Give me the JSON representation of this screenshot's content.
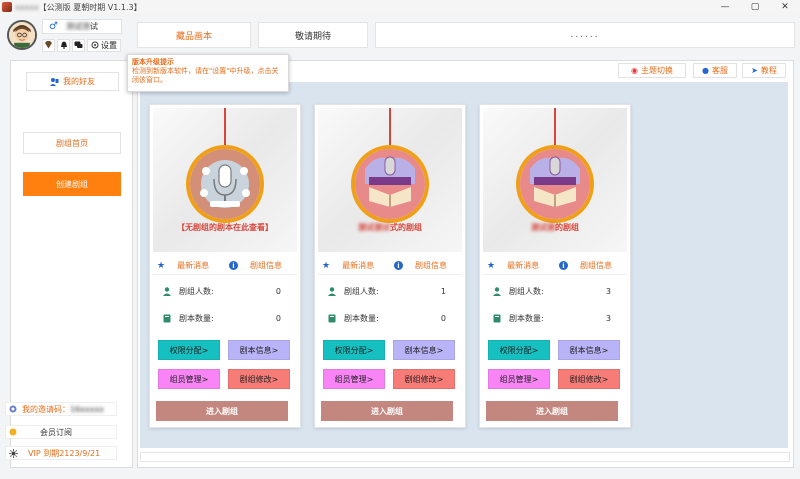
{
  "window": {
    "title_prefix": "【公测版 夏朝时期 V1.1.3】",
    "title_blur": "xxxxx",
    "minimize": "—",
    "maximize": "▢",
    "close": "✕"
  },
  "user": {
    "gender_symbol": "♂",
    "name_blur": "测试测",
    "name_suffix": "试",
    "settings_label": "设置"
  },
  "top": {
    "tab1": "藏品画本",
    "tab2": "敬请期待",
    "dots": "......"
  },
  "tooltip": {
    "title": "版本升级提示",
    "body": "检测到新版本软件，请在\"设置\"中升级，点击关闭该窗口。"
  },
  "sidebar": {
    "friends": "我的好友",
    "home": "剧组首页",
    "create": "创建剧组",
    "invite_label": "我的邀请码：",
    "invite_code": "16xxxxx",
    "subscription": "会员订阅",
    "vip": "VIP 到期2123/9/21"
  },
  "toolbar": {
    "theme": "主题切换",
    "service": "客服",
    "tutorial": "教程"
  },
  "cards": [
    {
      "caption_prefix": "【无剧组的剧本在此查看】",
      "caption_blur": "",
      "caption_suffix": "",
      "tab_news": "最新消息",
      "tab_info": "剧组信息",
      "members_label": "剧组人数:",
      "members": "0",
      "scripts_label": "剧本数量:",
      "scripts": "0",
      "btn_perm": "权限分配>",
      "btn_script": "剧本信息>",
      "btn_member": "组员管理>",
      "btn_edit": "剧组修改>",
      "btn_enter": "进入剧组"
    },
    {
      "caption_prefix": "",
      "caption_blur": "测试测试",
      "caption_suffix": "式的剧组",
      "tab_news": "最新消息",
      "tab_info": "剧组信息",
      "members_label": "剧组人数:",
      "members": "1",
      "scripts_label": "剧本数量:",
      "scripts": "0",
      "btn_perm": "权限分配>",
      "btn_script": "剧本信息>",
      "btn_member": "组员管理>",
      "btn_edit": "剧组修改>",
      "btn_enter": "进入剧组"
    },
    {
      "caption_prefix": "",
      "caption_blur": "测试测",
      "caption_suffix": "的剧组",
      "tab_news": "最新消息",
      "tab_info": "剧组信息",
      "members_label": "剧组人数:",
      "members": "3",
      "scripts_label": "剧本数量:",
      "scripts": "3",
      "btn_perm": "权限分配>",
      "btn_script": "剧本信息>",
      "btn_member": "组员管理>",
      "btn_edit": "剧组修改>",
      "btn_enter": "进入剧组"
    }
  ],
  "colors": {
    "accent": "#e66c1b",
    "primary_button": "#ff7f0f",
    "teal": "#16c0c0",
    "lavender": "#b9b4f7",
    "pink": "#f884f5",
    "red": "#f77c78",
    "enter": "#c3877f",
    "canvas_bg": "#d9e4ef"
  }
}
